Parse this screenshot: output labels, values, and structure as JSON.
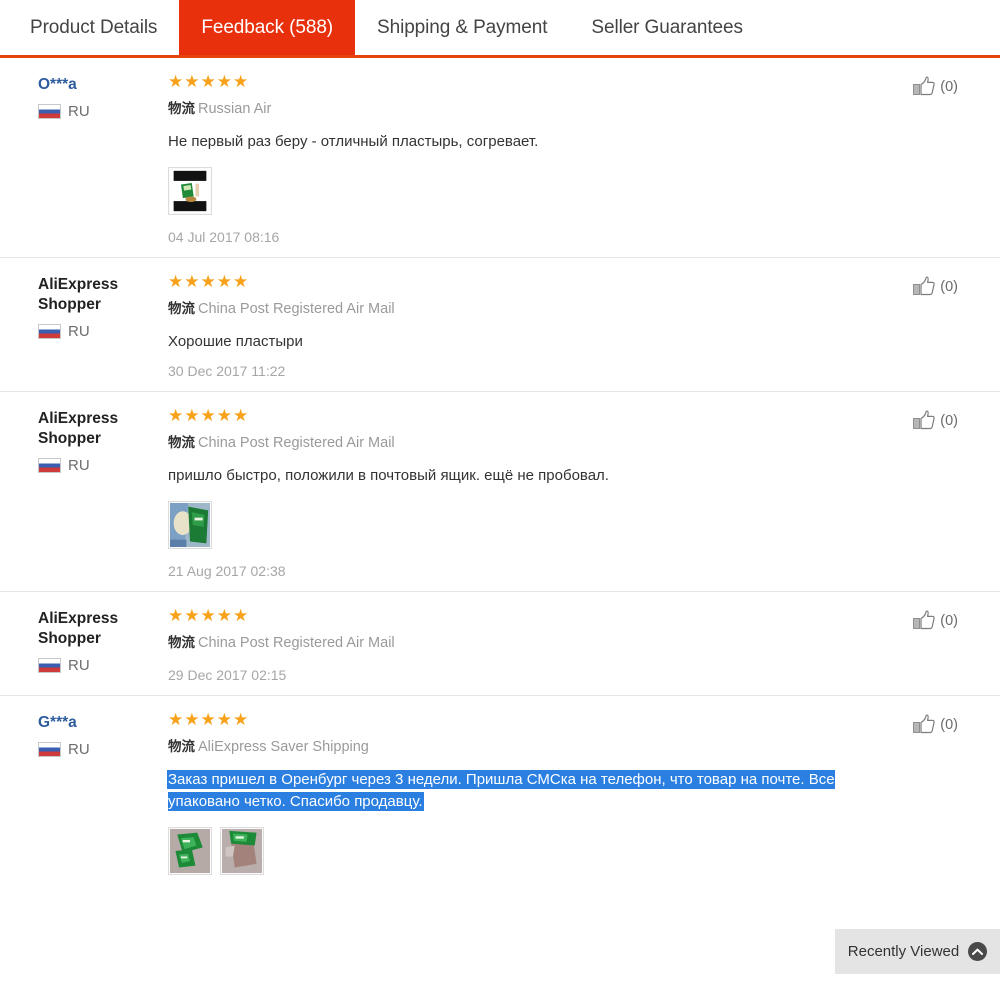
{
  "tabs": [
    {
      "label": "Product Details",
      "active": false
    },
    {
      "label": "Feedback (588)",
      "active": true
    },
    {
      "label": "Shipping & Payment",
      "active": false
    },
    {
      "label": "Seller Guarantees",
      "active": false
    }
  ],
  "colors": {
    "active_tab_bg": "#e8310c",
    "tabbar_underline": "#e8420c",
    "star": "#f8a11a",
    "username_link": "#2e5d9e",
    "selection_highlight": "#2a7fe0",
    "date_text": "#a6a6a6",
    "logistics_text": "#9a9a9a"
  },
  "logistics_label": "物流",
  "stars_glyph": "★★★★★",
  "feedback": [
    {
      "username": "O***a",
      "username_is_link": true,
      "country_code": "RU",
      "country_flag": "ru-flag-icon",
      "rating": 5,
      "shipping_method": "Russian Air",
      "comment": "Не первый раз беру - отличный пластырь, согревает.",
      "comment_selected": false,
      "photos": [
        "review-photo-letterboxed-green-product"
      ],
      "date": "04 Jul 2017 08:16",
      "helpful_count": "(0)"
    },
    {
      "username": "AliExpress Shopper",
      "username_is_link": false,
      "country_code": "RU",
      "country_flag": "ru-flag-icon",
      "rating": 5,
      "shipping_method": "China Post Registered Air Mail",
      "comment": "Хорошие пластыри",
      "comment_selected": false,
      "photos": [],
      "date": "30 Dec 2017 11:22",
      "helpful_count": "(0)"
    },
    {
      "username": "AliExpress Shopper",
      "username_is_link": false,
      "country_code": "RU",
      "country_flag": "ru-flag-icon",
      "rating": 5,
      "shipping_method": "China Post Registered Air Mail",
      "comment": "пришло быстро, положили в почтовый ящик. ещё не пробовал.",
      "comment_selected": false,
      "photos": [
        "review-photo-green-package-on-blue"
      ],
      "date": "21 Aug 2017 02:38",
      "helpful_count": "(0)"
    },
    {
      "username": "AliExpress Shopper",
      "username_is_link": false,
      "country_code": "RU",
      "country_flag": "ru-flag-icon",
      "rating": 5,
      "shipping_method": "China Post Registered Air Mail",
      "comment": "",
      "comment_selected": false,
      "photos": [],
      "date": "29 Dec 2017 02:15",
      "helpful_count": "(0)"
    },
    {
      "username": "G***a",
      "username_is_link": true,
      "country_code": "RU",
      "country_flag": "ru-flag-icon",
      "rating": 5,
      "shipping_method": "AliExpress Saver Shipping",
      "comment": "Заказ пришел в Оренбург через 3 недели. Пришла СМСка на телефон, что товар на почте. Все упаковано четко. Спасибо продавцу.",
      "comment_selected": true,
      "photos": [
        "review-photo-green-packets",
        "review-photo-green-packet-on-skin"
      ],
      "date": "",
      "helpful_count": "(0)"
    }
  ],
  "recently_viewed": {
    "label": "Recently Viewed",
    "chevron_icon": "chevron-up-icon"
  }
}
